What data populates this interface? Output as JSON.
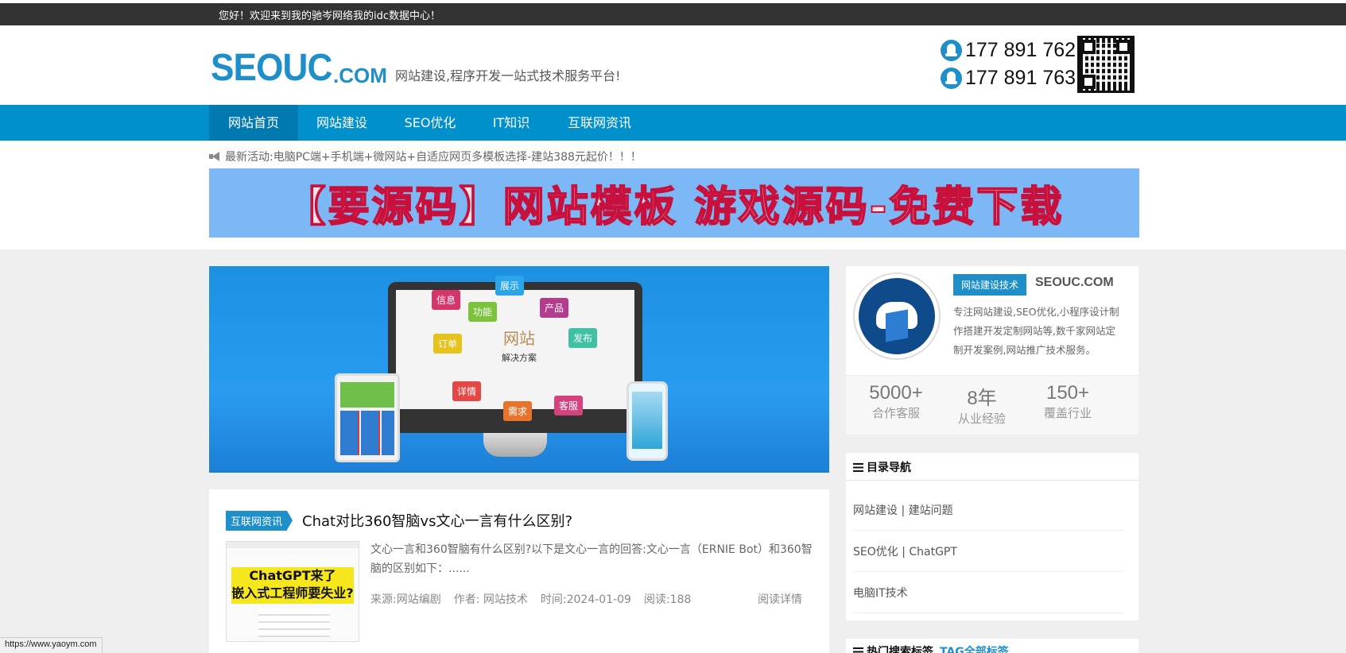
{
  "topbar": {
    "welcome": "您好！欢迎来到我的驰岑网络我的idc数据中心！"
  },
  "header": {
    "logo_main": "SEOUC",
    "logo_suffix": ".COM",
    "slogan": "网站建设,程序开发一站式技术服务平台!",
    "phone1": "177 891 762",
    "phone2": "177 891 763",
    "phone_icon": "qq-icon",
    "qr_icon": "qr-code-icon"
  },
  "nav": {
    "items": [
      {
        "label": "网站首页"
      },
      {
        "label": "网站建设"
      },
      {
        "label": "SEO优化"
      },
      {
        "label": "IT知识"
      },
      {
        "label": "互联网资讯"
      }
    ],
    "active_index": 0,
    "bg_color": "#0090cc"
  },
  "notice": {
    "text": "最新活动:电脑PC端+手机端+微网站+自适应网页多模板选择-建站388元起价！！！",
    "icon": "megaphone-icon"
  },
  "banner": {
    "text": "【要源码】网站模板 游戏源码-免费下载"
  },
  "hero": {
    "center_title": "网站",
    "center_sub": "解决方案",
    "tags": [
      "展示",
      "信息",
      "功能",
      "产品",
      "订单",
      "发布",
      "详情",
      "需求",
      "客服"
    ]
  },
  "article": {
    "category": "互联网资讯",
    "title": "Chat对比360智脑vs文心一言有什么区别?",
    "thumb_line1": "ChatGPT来了",
    "thumb_line2": "嵌入式工程师要失业?",
    "excerpt": "文心一言和360智脑有什么区别?以下是文心一言的回答:文心一言（ERNIE Bot）和360智脑的区别如下：......",
    "source": "来源:网站编剧",
    "author": "作者: 网站技术",
    "time": "时间:2024-01-09",
    "views": "阅读:188",
    "read_more": "阅读详情"
  },
  "profile": {
    "tag": "网站建设技术",
    "name": "SEOUC.COM",
    "desc": "专注网站建设,SEO优化,小程序设计制作搭建开发定制网站等,数千家网站定制开发案例,网站推广技术服务。",
    "stats": [
      {
        "value": "5000+",
        "label": "合作客服"
      },
      {
        "value": "8年",
        "label": "从业经验"
      },
      {
        "value": "150+",
        "label": "覆盖行业"
      }
    ]
  },
  "directory": {
    "title": "目录导航",
    "items": [
      {
        "label": "网站建设 | 建站问题"
      },
      {
        "label": "SEO优化 | ChatGPT"
      },
      {
        "label": "电脑IT技术"
      }
    ]
  },
  "hottags": {
    "title": "热门搜索标签",
    "all": "TAG全部标签"
  },
  "statusbar": {
    "url": "https://www.yaoym.com"
  }
}
